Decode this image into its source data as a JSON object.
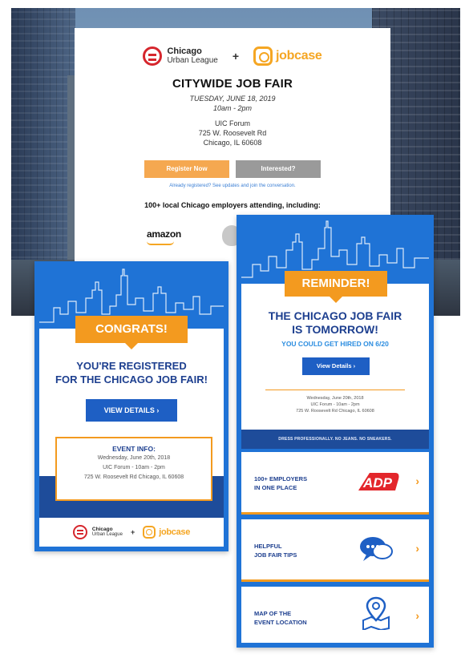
{
  "top_email": {
    "partner_left": {
      "line1": "Chicago",
      "line2": "Urban League"
    },
    "plus": "+",
    "partner_right": "jobcase",
    "title": "CITYWIDE JOB FAIR",
    "date": "TUESDAY, JUNE 18, 2019",
    "time": "10am - 2pm",
    "venue_name": "UIC Forum",
    "venue_street": "725 W. Roosevelt Rd",
    "venue_city": "Chicago, IL 60608",
    "register_label": "Register Now",
    "interested_label": "Interested?",
    "already_text": "Already registered? See updates and join the conversation.",
    "attending_text": "100+ local Chicago employers attending, including:",
    "employer_1": "amazon"
  },
  "congrats_email": {
    "banner": "CONGRATS!",
    "headline_1": "YOU'RE REGISTERED",
    "headline_2": "FOR THE CHICAGO JOB FAIR!",
    "button": "VIEW DETAILS ›",
    "event_header": "EVENT INFO:",
    "event_line_1": "Wednesday, June 20th, 2018",
    "event_line_2": "UIC Forum - 10am - 2pm",
    "event_line_3": "725 W. Roosevelt Rd Chicago, IL 60608",
    "footer_left_1": "Chicago",
    "footer_left_2": "Urban League",
    "footer_plus": "+",
    "footer_right": "jobcase"
  },
  "reminder_email": {
    "banner": "REMINDER!",
    "headline_1": "THE CHICAGO JOB FAIR",
    "headline_2": "IS TOMORROW!",
    "subline": "YOU COULD GET HIRED ON 6/20",
    "button": "View Details ›",
    "info_line_1": "Wednesday, June 20th, 2018",
    "info_line_2": "UIC Forum - 10am - 2pm",
    "info_line_3": "725 W. Roosevelt Rd Chicago, IL 60608",
    "dress_note": "DRESS PROFESSIONALLY. NO JEANS. NO SNEAKERS.",
    "tiles": [
      {
        "label": "100+ EMPLOYERS\nIN ONE PLACE",
        "icon": "adp-logo",
        "arrow": "›"
      },
      {
        "label": "HELPFUL\nJOB FAIR TIPS",
        "icon": "chat-bubbles-icon",
        "arrow": "›"
      },
      {
        "label": "MAP OF THE\nEVENT LOCATION",
        "icon": "map-pin-icon",
        "arrow": "›"
      }
    ]
  },
  "colors": {
    "brand_blue": "#1f73d6",
    "dark_blue": "#1e4c9a",
    "accent_orange": "#f39a1f",
    "cul_red": "#d6262d",
    "jobcase_orange": "#f5a623"
  }
}
